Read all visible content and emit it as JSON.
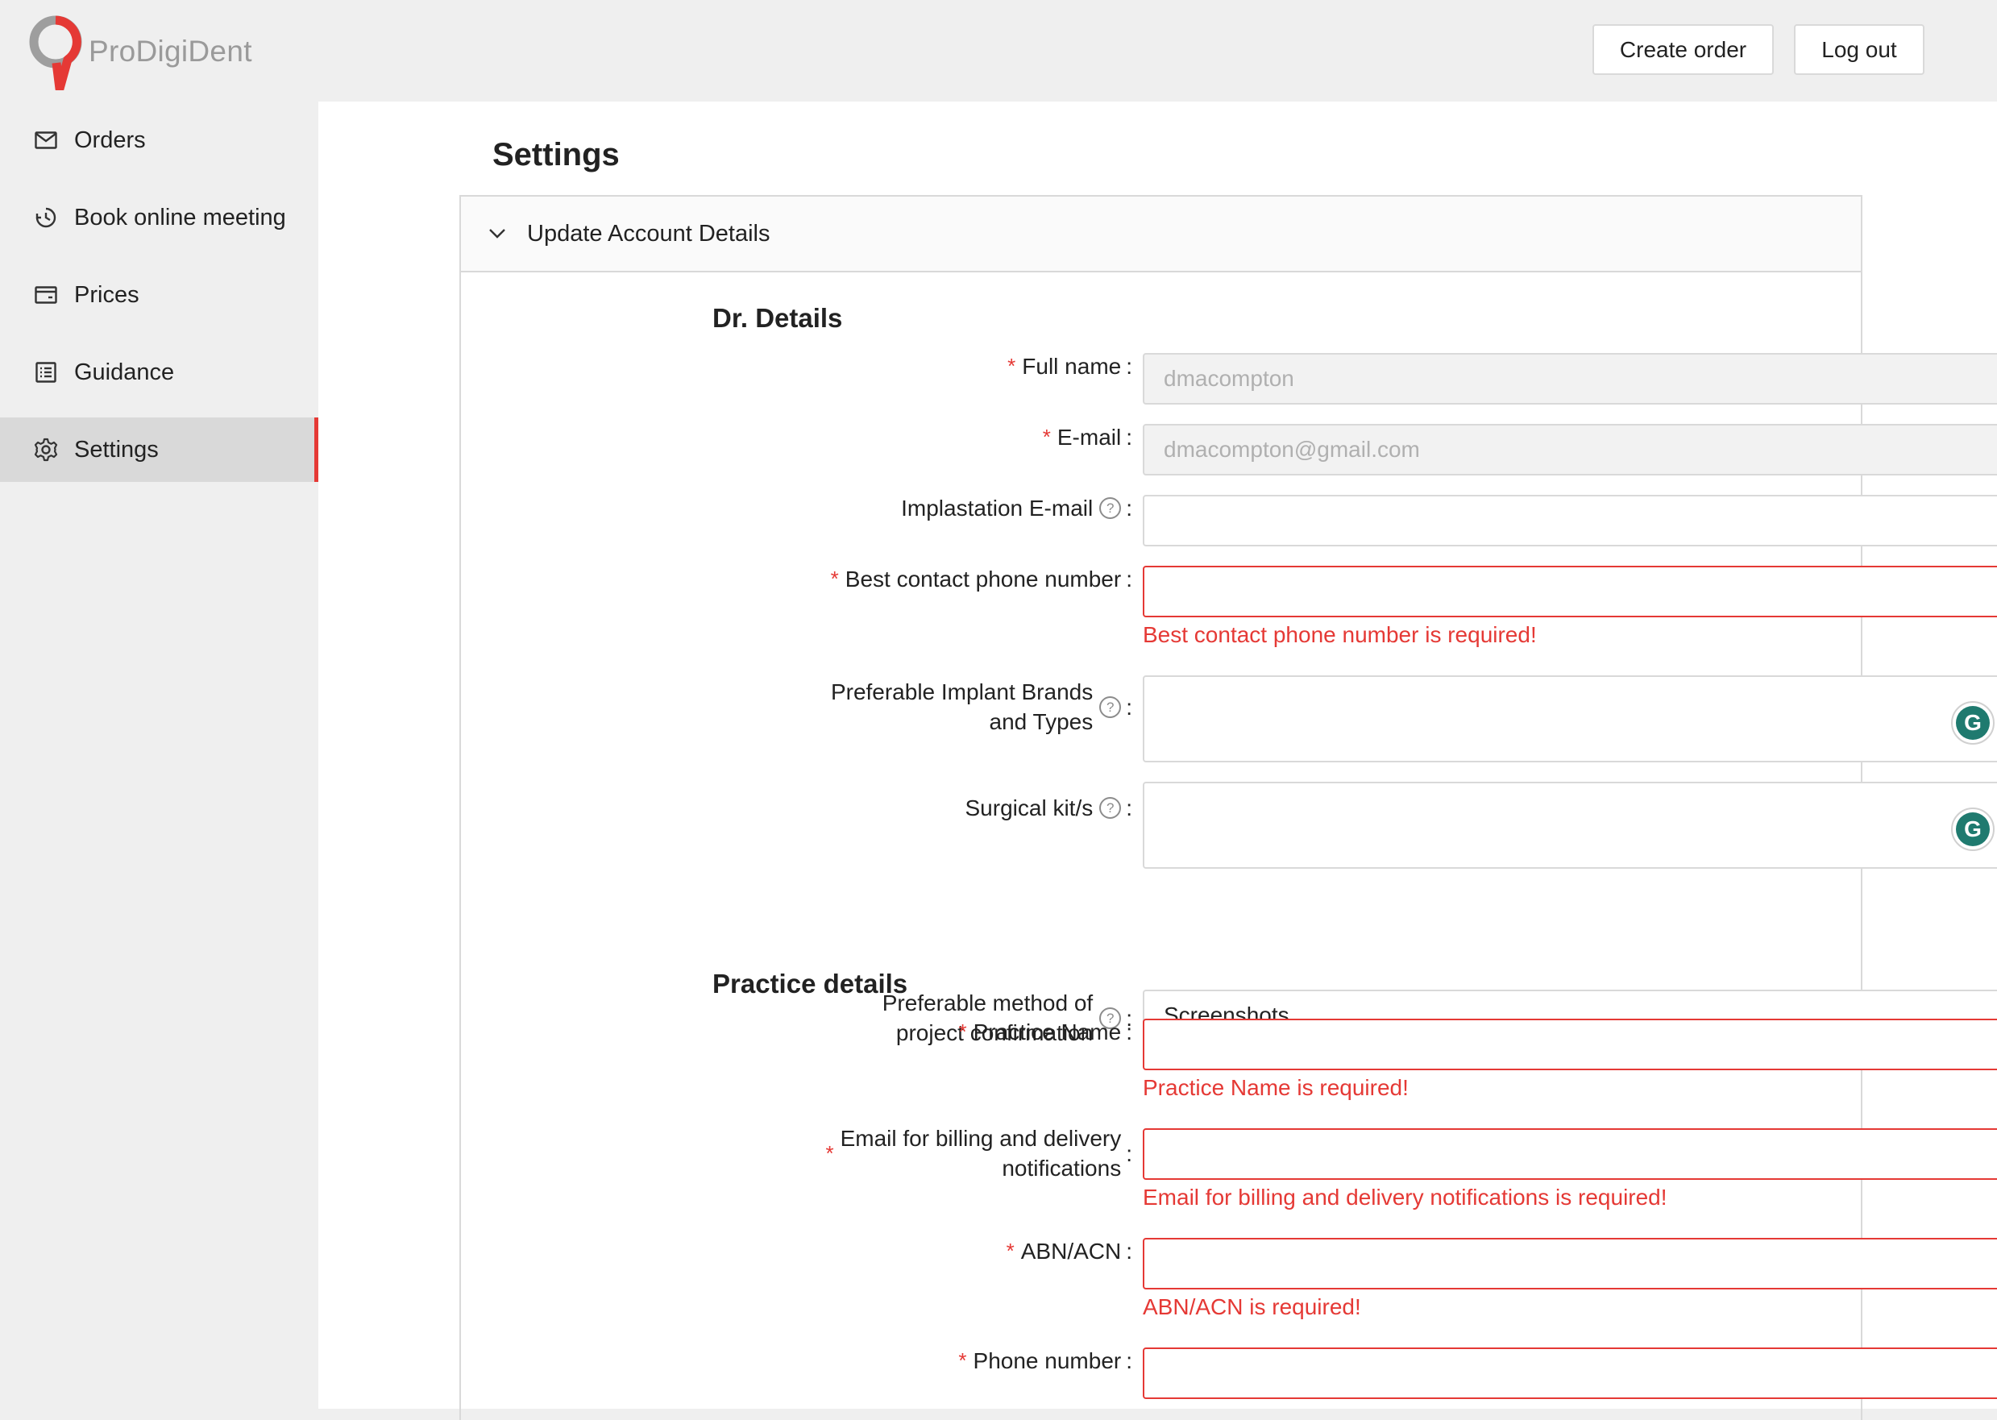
{
  "header": {
    "brand": "ProDigiDent",
    "create_order": "Create order",
    "log_out": "Log out",
    "accent": "#e53935"
  },
  "sidebar": {
    "items": [
      {
        "label": "Orders",
        "icon": "mail-icon"
      },
      {
        "label": "Book online meeting",
        "icon": "clock-icon"
      },
      {
        "label": "Prices",
        "icon": "card-icon"
      },
      {
        "label": "Guidance",
        "icon": "list-icon"
      },
      {
        "label": "Settings",
        "icon": "gear-icon",
        "active": true
      }
    ]
  },
  "main": {
    "title": "Settings",
    "panel_title": "Update Account Details",
    "section_dr": "Dr. Details",
    "section_practice": "Practice details",
    "fields": {
      "full_name": {
        "label": "Full name",
        "value": "dmacompton"
      },
      "email": {
        "label": "E-mail",
        "value": "dmacompton@gmail.com"
      },
      "implastation_email": {
        "label": "Implastation E-mail",
        "value": ""
      },
      "best_phone": {
        "label": "Best contact phone number",
        "value": "",
        "error": "Best contact phone number is required!"
      },
      "implant_brands": {
        "label_1": "Preferable Implant Brands",
        "label_2": "and Types",
        "value": ""
      },
      "surgical_kits": {
        "label": "Surgical kit/s",
        "value": ""
      },
      "confirmation_method": {
        "label_1": "Preferable method of",
        "label_2": "project confirmation",
        "value": "Screenshots"
      },
      "practice_name": {
        "label": "Practice Name",
        "value": "",
        "error": "Practice Name is required!"
      },
      "billing_email": {
        "label_1": "Email for billing and delivery",
        "label_2": "notifications",
        "value": "",
        "error": "Email for billing and delivery notifications is required!"
      },
      "abn_acn": {
        "label": "ABN/ACN",
        "value": "",
        "error": "ABN/ACN is required!"
      },
      "phone_number": {
        "label": "Phone number",
        "value": ""
      }
    }
  },
  "symbols": {
    "colon": ":",
    "required": "*",
    "help": "?",
    "ok": "✓",
    "err": "×",
    "grammarly": "G"
  }
}
